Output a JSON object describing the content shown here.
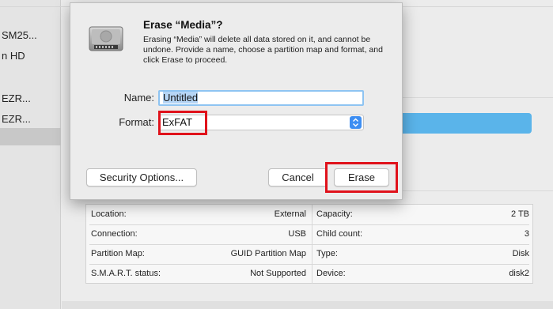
{
  "sidebar": {
    "items": [
      {
        "label": "SM25..."
      },
      {
        "label": "n HD"
      },
      {
        "label": "EZR..."
      },
      {
        "label": "EZR..."
      }
    ]
  },
  "dialog": {
    "title": "Erase “Media”?",
    "message": "Erasing “Media” will delete all data stored on it, and cannot be undone. Provide a name, choose a partition map and format, and click Erase to proceed.",
    "name_label": "Name:",
    "name_value": "Untitled",
    "format_label": "Format:",
    "format_value": "ExFAT",
    "security_button": "Security Options...",
    "cancel_button": "Cancel",
    "erase_button": "Erase"
  },
  "info": {
    "left": [
      {
        "key": "Location:",
        "value": "External"
      },
      {
        "key": "Connection:",
        "value": "USB"
      },
      {
        "key": "Partition Map:",
        "value": "GUID Partition Map"
      },
      {
        "key": "S.M.A.R.T. status:",
        "value": "Not Supported"
      }
    ],
    "right": [
      {
        "key": "Capacity:",
        "value": "2 TB"
      },
      {
        "key": "Child count:",
        "value": "3"
      },
      {
        "key": "Type:",
        "value": "Disk"
      },
      {
        "key": "Device:",
        "value": "disk2"
      }
    ]
  },
  "colors": {
    "highlight_box": "#e0121b",
    "accent_blue": "#3d8ef2",
    "progress_blue": "#5ab4ea"
  }
}
